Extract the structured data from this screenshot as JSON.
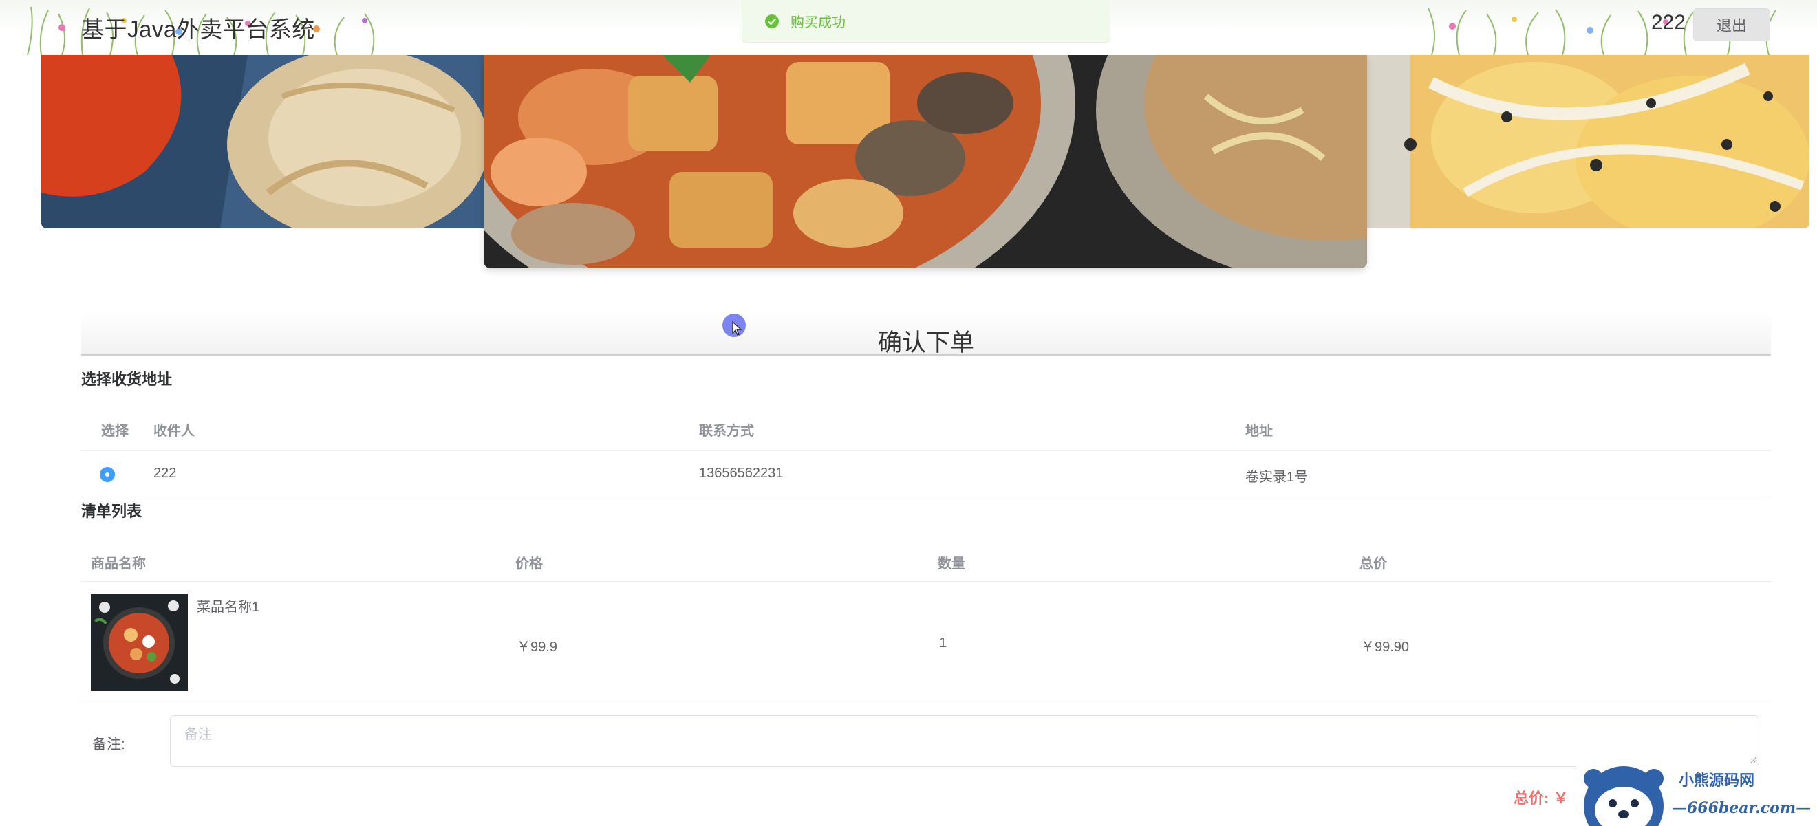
{
  "header": {
    "site_title": "基于Java外卖平台系统",
    "username": "222",
    "logout_label": "退出"
  },
  "toast": {
    "message": "购买成功",
    "type": "success"
  },
  "carousel": {
    "slide_count": 3,
    "active_index": 2
  },
  "order": {
    "title": "确认下单",
    "address_section_title": "选择收货地址",
    "address_columns": [
      "选择",
      "收件人",
      "联系方式",
      "地址"
    ],
    "addresses": [
      {
        "selected": true,
        "receiver": "222",
        "phone": "13656562231",
        "address": "卷实录1号"
      }
    ],
    "list_section_title": "清单列表",
    "list_columns": [
      "商品名称",
      "价格",
      "数量",
      "总价"
    ],
    "items": [
      {
        "name": "菜品名称1",
        "price": "￥99.9",
        "quantity": "1",
        "subtotal": "￥99.90"
      }
    ],
    "remark_label": "备注:",
    "remark_placeholder": "备注",
    "remark_value": "",
    "total_label": "总价: ￥"
  },
  "watermark": {
    "line1": "小熊源码网",
    "line2": "—666bear.com—"
  },
  "colors": {
    "success": "#67c23a",
    "primary": "#409eff",
    "danger": "#f56c6c"
  }
}
